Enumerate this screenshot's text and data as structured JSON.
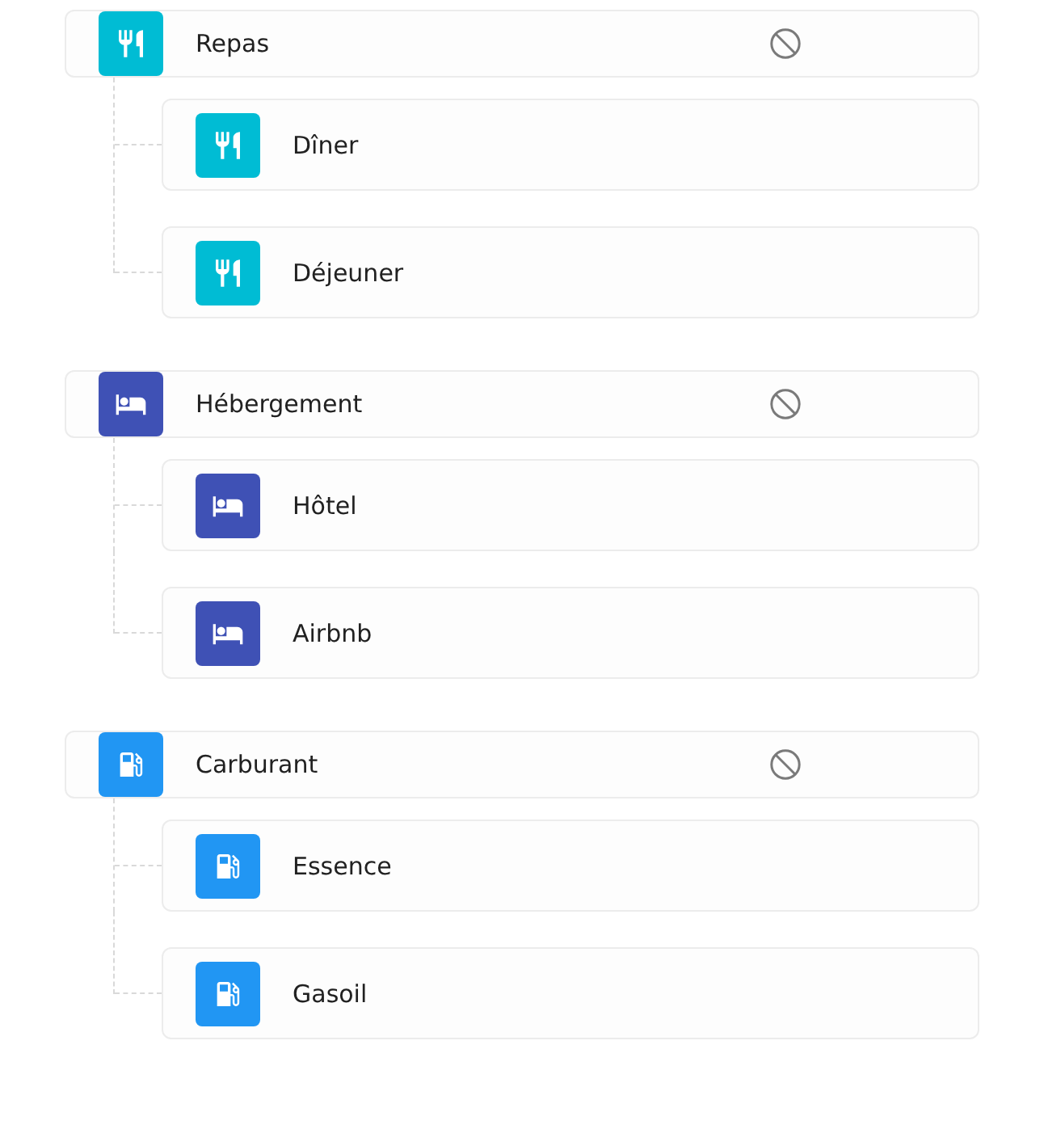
{
  "groups": [
    {
      "label": "Repas",
      "kind": "meal",
      "color": "#00bcd4",
      "blocked": true,
      "children": [
        {
          "label": "Dîner",
          "blocked": false
        },
        {
          "label": "Déjeuner",
          "blocked": false
        }
      ]
    },
    {
      "label": "Hébergement",
      "kind": "lodging",
      "color": "#3f51b5",
      "blocked": true,
      "children": [
        {
          "label": "Hôtel",
          "blocked": false
        },
        {
          "label": "Airbnb",
          "blocked": false
        }
      ]
    },
    {
      "label": "Carburant",
      "kind": "fuel",
      "color": "#2196f3",
      "blocked": true,
      "children": [
        {
          "label": "Essence",
          "blocked": false
        },
        {
          "label": "Gasoil",
          "blocked": false
        }
      ]
    }
  ]
}
